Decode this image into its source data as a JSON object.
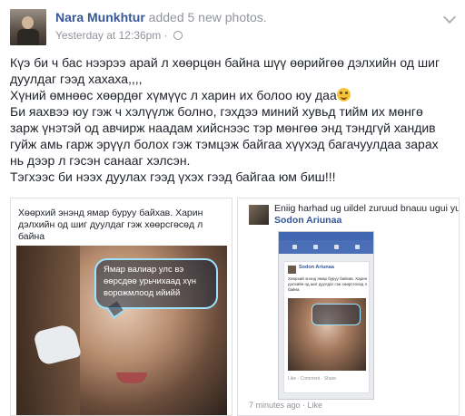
{
  "post": {
    "author": "Nara Munkhtur",
    "action": " added 5 new photos.",
    "timestamp": "Yesterday at 12:36pm",
    "separator": " · ",
    "privacy_icon": "globe-icon",
    "menu_icon": "chevron-down-icon",
    "text_lines": [
      "Күэ би ч бас нээрээ арай л хөөрцөн байна шүү өөрийгөө дэлхийн од шиг",
      "дуулдаг гээд хахаха,,,,",
      "Хүний өмнөөс хөөрдөг хүмүүс л харин их болоо юу даа",
      "Би яахвээ юу гэж ч хэлүүлж болно, гэхдээ миний хувьд тийм их мөнгө",
      "зарж үнэтэй од авчирж наадам хийснээс тэр мөнгөө энд тэндгүй хандив",
      "гуйж амь гарж эрүүл болох гэж тэмцэж байгаа хүүхэд багачуулдаа зарах",
      "нь дээр л гэсэн санааг хэлсэн.",
      "Тэгхээс би нээх дуулах гээд үхэх гээд байгаа юм биш!!!"
    ],
    "emoji_icon": "grinning-emoji-icon"
  },
  "photo_left": {
    "caption": "Хөөрхий энэнд ямар буруу байхав. Харин дэлхийн од шиг дуулдаг гэж хөөрсгөсөд л байна",
    "bubble": "Ямар валиар улс вэ өөрсдөө урьчихаад хүн ворожмлоод ийийй"
  },
  "photo_right": {
    "comment_line1": "Eniig harhad ug uildel zuruud bnauu ugui yu",
    "commenter": "Sodon Ariunaa",
    "mini_name": "Sodon Ariunaa",
    "mini_text": "Хөөрхий энэнд ямар буруу байхав. Харин дэлхийн од шиг дуулдаг гэж хөөрсгөсөд л байна",
    "mini_actions": "Like · Comment · Share",
    "time": "7 minutes ago",
    "like": "Like"
  }
}
